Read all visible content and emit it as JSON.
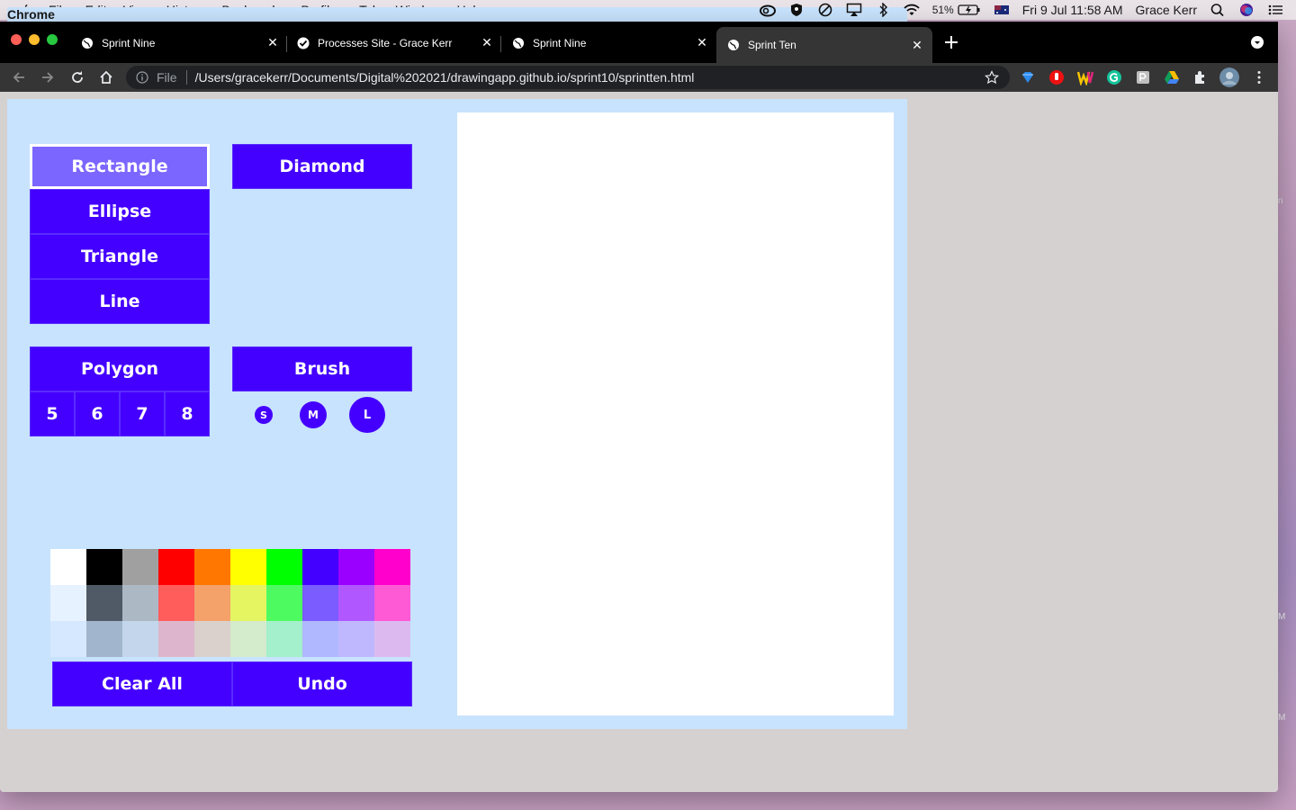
{
  "menubar": {
    "app_name": "Chrome",
    "items": [
      "File",
      "Edit",
      "View",
      "History",
      "Bookmarks",
      "Profiles",
      "Tab",
      "Window",
      "Help"
    ],
    "battery": "51%",
    "clock": "Fri 9 Jul  11:58 AM",
    "user": "Grace Kerr"
  },
  "tabs": [
    {
      "title": "Sprint Nine",
      "icon": "globe-icon"
    },
    {
      "title": "Processes Site - Grace Kerr",
      "icon": "check-icon"
    },
    {
      "title": "Sprint Nine",
      "icon": "globe-icon"
    },
    {
      "title": "Sprint Ten",
      "icon": "globe-icon",
      "active": true
    }
  ],
  "address_bar": {
    "scheme_label": "File",
    "url": "/Users/gracekerr/Documents/Digital%202021/drawingapp.github.io/sprint10/sprintten.html"
  },
  "shape_buttons": {
    "rectangle": "Rectangle",
    "ellipse": "Ellipse",
    "triangle": "Triangle",
    "line": "Line",
    "diamond": "Diamond",
    "polygon": "Polygon",
    "brush": "Brush"
  },
  "polygon_sides": [
    "5",
    "6",
    "7",
    "8"
  ],
  "brush_sizes": [
    "S",
    "M",
    "L"
  ],
  "palette": [
    [
      "#ffffff",
      "#000000",
      "#a0a0a0",
      "#ff0000",
      "#ff7700",
      "#ffff00",
      "#00ff00",
      "#4400ff",
      "#9900ff",
      "#ff00cc"
    ],
    [
      "#e6f2ff",
      "#4f5a66",
      "#acb8c4",
      "#ff5c5c",
      "#f4a26a",
      "#e4f561",
      "#4dfb61",
      "#7a5cff",
      "#b057ff",
      "#ff5ad6"
    ],
    [
      "#d6e8ff",
      "#a1b6cc",
      "#c3d6eb",
      "#ddb6cd",
      "#dad0cc",
      "#d4ebcc",
      "#a4efcc",
      "#b0b8ff",
      "#c0b8ff",
      "#dcbaf0"
    ]
  ],
  "actions": {
    "clear_all": "Clear All",
    "undo": "Undo"
  },
  "colors": {
    "button": "#4400ff",
    "active_button": "#7b66ff",
    "app_background": "#c8e3fd"
  }
}
